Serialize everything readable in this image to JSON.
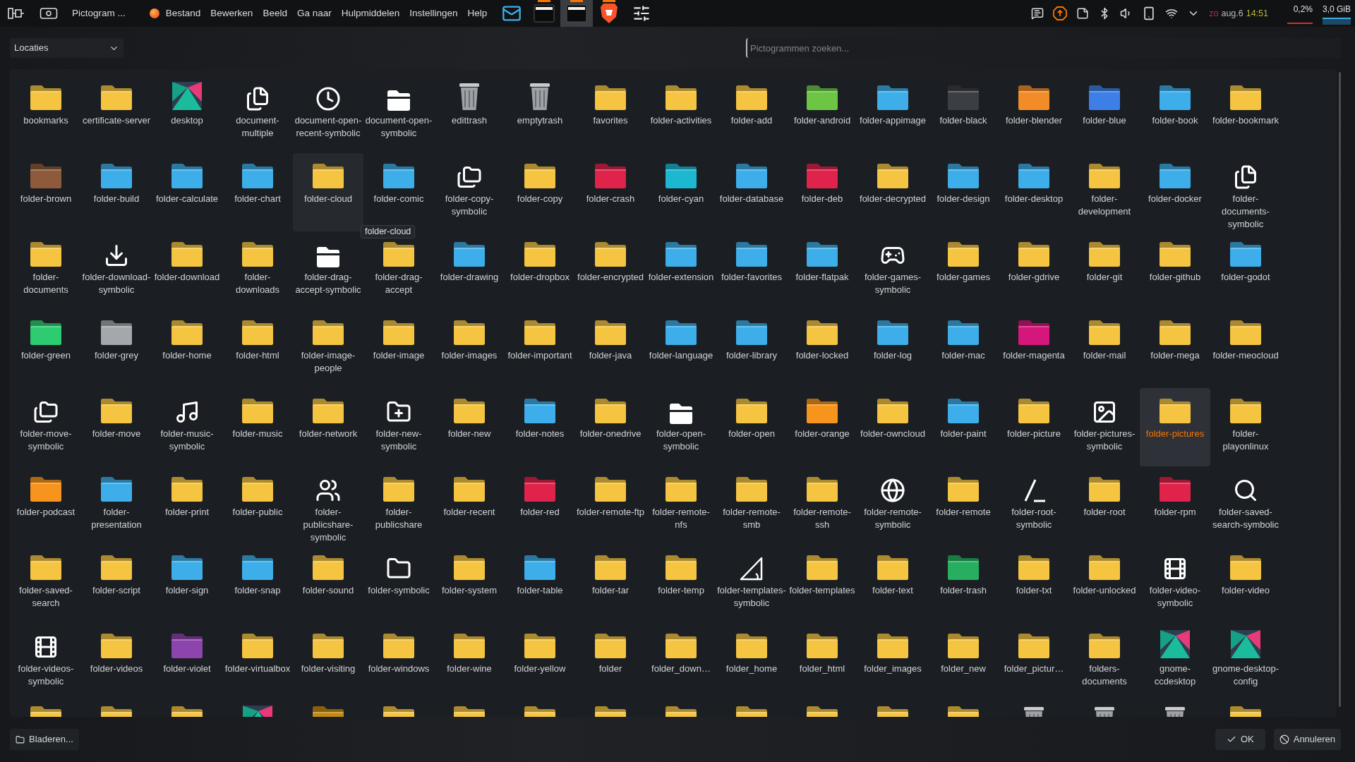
{
  "topbar": {
    "title": "Pictogram ...",
    "menu": [
      "Bestand",
      "Bewerken",
      "Beeld",
      "Ga naar",
      "Hulpmiddelen",
      "Instellingen",
      "Help"
    ],
    "tasks": [
      {
        "kind": "mail",
        "active": false,
        "running": false
      },
      {
        "kind": "window",
        "active": false,
        "running": true
      },
      {
        "kind": "window",
        "active": true,
        "running": true
      },
      {
        "kind": "browser",
        "active": false,
        "running": true
      },
      {
        "kind": "settings",
        "active": false,
        "running": false
      }
    ],
    "clock": {
      "day": "zo",
      "date": "aug.6",
      "time": "14:51"
    },
    "monitors": [
      "0,2%",
      "3,0 GiB"
    ]
  },
  "dialog": {
    "location": "Locaties",
    "search": {
      "placeholder": "Pictogrammen zoeken..."
    },
    "tooltip": "folder-cloud",
    "icons": [
      {
        "label": "bookmarks",
        "kind": "folder",
        "color": "#f5c542",
        "selected": false,
        "hovered": false
      },
      {
        "label": "certificate-server",
        "kind": "folder",
        "color": "#f5c542",
        "selected": false,
        "hovered": false
      },
      {
        "label": "desktop",
        "kind": "desktop",
        "selected": false,
        "hovered": false
      },
      {
        "label": "document-multiple",
        "kind": "files",
        "selected": false,
        "hovered": false
      },
      {
        "label": "document-open-recent-symbolic",
        "kind": "clock",
        "selected": false,
        "hovered": false
      },
      {
        "label": "document-open-symbolic",
        "kind": "whitefolder",
        "selected": false,
        "hovered": false
      },
      {
        "label": "edittrash",
        "kind": "trash",
        "selected": false,
        "hovered": false
      },
      {
        "label": "emptytrash",
        "kind": "trash",
        "selected": false,
        "hovered": false
      },
      {
        "label": "favorites",
        "kind": "folder",
        "color": "#f5c542",
        "selected": false,
        "hovered": false
      },
      {
        "label": "folder-activities",
        "kind": "folder",
        "color": "#f5c542",
        "selected": false,
        "hovered": false
      },
      {
        "label": "folder-add",
        "kind": "folder",
        "color": "#f5c542",
        "selected": false,
        "hovered": false
      },
      {
        "label": "folder-android",
        "kind": "folder",
        "color": "#6cc644",
        "selected": false,
        "hovered": false
      },
      {
        "label": "folder-appimage",
        "kind": "folder",
        "color": "#3daee9",
        "selected": false,
        "hovered": false
      },
      {
        "label": "folder-black",
        "kind": "folder",
        "color": "#3b3e42",
        "selected": false,
        "hovered": false
      },
      {
        "label": "folder-blender",
        "kind": "folder",
        "color": "#f28c28",
        "selected": false,
        "hovered": false
      },
      {
        "label": "folder-blue",
        "kind": "folder",
        "color": "#3d7fe6",
        "selected": false,
        "hovered": false
      },
      {
        "label": "folder-book",
        "kind": "folder",
        "color": "#3daee9",
        "selected": false,
        "hovered": false
      },
      {
        "label": "folder-bookmark",
        "kind": "folder",
        "color": "#f5c542",
        "selected": false,
        "hovered": false
      },
      {
        "label": "folder-brown",
        "kind": "folder",
        "color": "#8d5b3c",
        "selected": false,
        "hovered": false
      },
      {
        "label": "folder-build",
        "kind": "folder",
        "color": "#3daee9",
        "selected": false,
        "hovered": false
      },
      {
        "label": "folder-calculate",
        "kind": "folder",
        "color": "#3daee9",
        "selected": false,
        "hovered": false
      },
      {
        "label": "folder-chart",
        "kind": "folder",
        "color": "#3daee9",
        "selected": false,
        "hovered": false
      },
      {
        "label": "folder-cloud",
        "kind": "folder",
        "color": "#f5c542",
        "selected": false,
        "hovered": true
      },
      {
        "label": "folder-comic",
        "kind": "folder",
        "color": "#3daee9",
        "selected": false,
        "hovered": false
      },
      {
        "label": "folder-copy-symbolic",
        "kind": "folders",
        "selected": false,
        "hovered": false
      },
      {
        "label": "folder-copy",
        "kind": "folder",
        "color": "#f5c542",
        "selected": false,
        "hovered": false
      },
      {
        "label": "folder-crash",
        "kind": "folder",
        "color": "#e0234b",
        "selected": false,
        "hovered": false
      },
      {
        "label": "folder-cyan",
        "kind": "folder",
        "color": "#1cb7d1",
        "selected": false,
        "hovered": false
      },
      {
        "label": "folder-database",
        "kind": "folder",
        "color": "#3daee9",
        "selected": false,
        "hovered": false
      },
      {
        "label": "folder-deb",
        "kind": "folder",
        "color": "#e0234b",
        "selected": false,
        "hovered": false
      },
      {
        "label": "folder-decrypted",
        "kind": "folder",
        "color": "#f5c542",
        "selected": false,
        "hovered": false
      },
      {
        "label": "folder-design",
        "kind": "folder",
        "color": "#3daee9",
        "selected": false,
        "hovered": false
      },
      {
        "label": "folder-desktop",
        "kind": "folder",
        "color": "#3daee9",
        "selected": false,
        "hovered": false
      },
      {
        "label": "folder-development",
        "kind": "folder",
        "color": "#f5c542",
        "selected": false,
        "hovered": false
      },
      {
        "label": "folder-docker",
        "kind": "folder",
        "color": "#3daee9",
        "selected": false,
        "hovered": false
      },
      {
        "label": "folder-documents-symbolic",
        "kind": "files",
        "selected": false,
        "hovered": false
      },
      {
        "label": "folder-documents",
        "kind": "folder",
        "color": "#f5c542",
        "selected": false,
        "hovered": false
      },
      {
        "label": "folder-download-symbolic",
        "kind": "download",
        "selected": false,
        "hovered": false
      },
      {
        "label": "folder-download",
        "kind": "folder",
        "color": "#f5c542",
        "selected": false,
        "hovered": false
      },
      {
        "label": "folder-downloads",
        "kind": "folder",
        "color": "#f5c542",
        "selected": false,
        "hovered": false
      },
      {
        "label": "folder-drag-accept-symbolic",
        "kind": "whitefolder",
        "selected": false,
        "hovered": false
      },
      {
        "label": "folder-drag-accept",
        "kind": "folder",
        "color": "#f5c542",
        "selected": false,
        "hovered": false
      },
      {
        "label": "folder-drawing",
        "kind": "folder",
        "color": "#3daee9",
        "selected": false,
        "hovered": false
      },
      {
        "label": "folder-dropbox",
        "kind": "folder",
        "color": "#f5c542",
        "selected": false,
        "hovered": false
      },
      {
        "label": "folder-encrypted",
        "kind": "folder",
        "color": "#f5c542",
        "selected": false,
        "hovered": false
      },
      {
        "label": "folder-extension",
        "kind": "folder",
        "color": "#3daee9",
        "selected": false,
        "hovered": false
      },
      {
        "label": "folder-favorites",
        "kind": "folder",
        "color": "#3daee9",
        "selected": false,
        "hovered": false
      },
      {
        "label": "folder-flatpak",
        "kind": "folder",
        "color": "#3daee9",
        "selected": false,
        "hovered": false
      },
      {
        "label": "folder-games-symbolic",
        "kind": "gamepad",
        "selected": false,
        "hovered": false
      },
      {
        "label": "folder-games",
        "kind": "folder",
        "color": "#f5c542",
        "selected": false,
        "hovered": false
      },
      {
        "label": "folder-gdrive",
        "kind": "folder",
        "color": "#f5c542",
        "selected": false,
        "hovered": false
      },
      {
        "label": "folder-git",
        "kind": "folder",
        "color": "#f5c542",
        "selected": false,
        "hovered": false
      },
      {
        "label": "folder-github",
        "kind": "folder",
        "color": "#f5c542",
        "selected": false,
        "hovered": false
      },
      {
        "label": "folder-godot",
        "kind": "folder",
        "color": "#3daee9",
        "selected": false,
        "hovered": false
      },
      {
        "label": "folder-green",
        "kind": "folder",
        "color": "#2ecc71",
        "selected": false,
        "hovered": false
      },
      {
        "label": "folder-grey",
        "kind": "folder",
        "color": "#a4a8ad",
        "selected": false,
        "hovered": false
      },
      {
        "label": "folder-home",
        "kind": "folder",
        "color": "#f5c542",
        "selected": false,
        "hovered": false
      },
      {
        "label": "folder-html",
        "kind": "folder",
        "color": "#f5c542",
        "selected": false,
        "hovered": false
      },
      {
        "label": "folder-image-people",
        "kind": "folder",
        "color": "#f5c542",
        "selected": false,
        "hovered": false
      },
      {
        "label": "folder-image",
        "kind": "folder",
        "color": "#f5c542",
        "selected": false,
        "hovered": false
      },
      {
        "label": "folder-images",
        "kind": "folder",
        "color": "#f5c542",
        "selected": false,
        "hovered": false
      },
      {
        "label": "folder-important",
        "kind": "folder",
        "color": "#f5c542",
        "selected": false,
        "hovered": false
      },
      {
        "label": "folder-java",
        "kind": "folder",
        "color": "#f5c542",
        "selected": false,
        "hovered": false
      },
      {
        "label": "folder-language",
        "kind": "folder",
        "color": "#3daee9",
        "selected": false,
        "hovered": false
      },
      {
        "label": "folder-library",
        "kind": "folder",
        "color": "#3daee9",
        "selected": false,
        "hovered": false
      },
      {
        "label": "folder-locked",
        "kind": "folder",
        "color": "#f5c542",
        "selected": false,
        "hovered": false
      },
      {
        "label": "folder-log",
        "kind": "folder",
        "color": "#3daee9",
        "selected": false,
        "hovered": false
      },
      {
        "label": "folder-mac",
        "kind": "folder",
        "color": "#3daee9",
        "selected": false,
        "hovered": false
      },
      {
        "label": "folder-magenta",
        "kind": "folder",
        "color": "#d5167a",
        "selected": false,
        "hovered": false
      },
      {
        "label": "folder-mail",
        "kind": "folder",
        "color": "#f5c542",
        "selected": false,
        "hovered": false
      },
      {
        "label": "folder-mega",
        "kind": "folder",
        "color": "#f5c542",
        "selected": false,
        "hovered": false
      },
      {
        "label": "folder-meocloud",
        "kind": "folder",
        "color": "#f5c542",
        "selected": false,
        "hovered": false
      },
      {
        "label": "folder-move-symbolic",
        "kind": "folders",
        "selected": false,
        "hovered": false
      },
      {
        "label": "folder-move",
        "kind": "folder",
        "color": "#f5c542",
        "selected": false,
        "hovered": false
      },
      {
        "label": "folder-music-symbolic",
        "kind": "music",
        "selected": false,
        "hovered": false
      },
      {
        "label": "folder-music",
        "kind": "folder",
        "color": "#f5c542",
        "selected": false,
        "hovered": false
      },
      {
        "label": "folder-network",
        "kind": "folder",
        "color": "#f5c542",
        "selected": false,
        "hovered": false
      },
      {
        "label": "folder-new-symbolic",
        "kind": "folderplus",
        "selected": false,
        "hovered": false
      },
      {
        "label": "folder-new",
        "kind": "folder",
        "color": "#f5c542",
        "selected": false,
        "hovered": false
      },
      {
        "label": "folder-notes",
        "kind": "folder",
        "color": "#3daee9",
        "selected": false,
        "hovered": false
      },
      {
        "label": "folder-onedrive",
        "kind": "folder",
        "color": "#f5c542",
        "selected": false,
        "hovered": false
      },
      {
        "label": "folder-open-symbolic",
        "kind": "whitefolder",
        "selected": false,
        "hovered": false
      },
      {
        "label": "folder-open",
        "kind": "folder",
        "color": "#f5c542",
        "selected": false,
        "hovered": false
      },
      {
        "label": "folder-orange",
        "kind": "folder",
        "color": "#f7941d",
        "selected": false,
        "hovered": false
      },
      {
        "label": "folder-owncloud",
        "kind": "folder",
        "color": "#f5c542",
        "selected": false,
        "hovered": false
      },
      {
        "label": "folder-paint",
        "kind": "folder",
        "color": "#3daee9",
        "selected": false,
        "hovered": false
      },
      {
        "label": "folder-picture",
        "kind": "folder",
        "color": "#f5c542",
        "selected": false,
        "hovered": false
      },
      {
        "label": "folder-pictures-symbolic",
        "kind": "image",
        "selected": false,
        "hovered": false
      },
      {
        "label": "folder-pictures",
        "kind": "folder",
        "color": "#f5c542",
        "selected": true,
        "hovered": false
      },
      {
        "label": "folder-playonlinux",
        "kind": "folder",
        "color": "#f5c542",
        "selected": false,
        "hovered": false
      },
      {
        "label": "folder-podcast",
        "kind": "folder",
        "color": "#f7941d",
        "selected": false,
        "hovered": false
      },
      {
        "label": "folder-presentation",
        "kind": "folder",
        "color": "#3daee9",
        "selected": false,
        "hovered": false
      },
      {
        "label": "folder-print",
        "kind": "folder",
        "color": "#f5c542",
        "selected": false,
        "hovered": false
      },
      {
        "label": "folder-public",
        "kind": "folder",
        "color": "#f5c542",
        "selected": false,
        "hovered": false
      },
      {
        "label": "folder-publicshare-symbolic",
        "kind": "users",
        "selected": false,
        "hovered": false
      },
      {
        "label": "folder-publicshare",
        "kind": "folder",
        "color": "#f5c542",
        "selected": false,
        "hovered": false
      },
      {
        "label": "folder-recent",
        "kind": "folder",
        "color": "#f5c542",
        "selected": false,
        "hovered": false
      },
      {
        "label": "folder-red",
        "kind": "folder",
        "color": "#e0234b",
        "selected": false,
        "hovered": false
      },
      {
        "label": "folder-remote-ftp",
        "kind": "folder",
        "color": "#f5c542",
        "selected": false,
        "hovered": false
      },
      {
        "label": "folder-remote-nfs",
        "kind": "folder",
        "color": "#f5c542",
        "selected": false,
        "hovered": false
      },
      {
        "label": "folder-remote-smb",
        "kind": "folder",
        "color": "#f5c542",
        "selected": false,
        "hovered": false
      },
      {
        "label": "folder-remote-ssh",
        "kind": "folder",
        "color": "#f5c542",
        "selected": false,
        "hovered": false
      },
      {
        "label": "folder-remote-symbolic",
        "kind": "globe",
        "selected": false,
        "hovered": false
      },
      {
        "label": "folder-remote",
        "kind": "folder",
        "color": "#f5c542",
        "selected": false,
        "hovered": false
      },
      {
        "label": "folder-root-symbolic",
        "kind": "slash",
        "selected": false,
        "hovered": false
      },
      {
        "label": "folder-root",
        "kind": "folder",
        "color": "#f5c542",
        "selected": false,
        "hovered": false
      },
      {
        "label": "folder-rpm",
        "kind": "folder",
        "color": "#e0234b",
        "selected": false,
        "hovered": false
      },
      {
        "label": "folder-saved-search-symbolic",
        "kind": "search",
        "selected": false,
        "hovered": false
      },
      {
        "label": "folder-saved-search",
        "kind": "folder",
        "color": "#f5c542",
        "selected": false,
        "hovered": false
      },
      {
        "label": "folder-script",
        "kind": "folder",
        "color": "#f5c542",
        "selected": false,
        "hovered": false
      },
      {
        "label": "folder-sign",
        "kind": "folder",
        "color": "#3daee9",
        "selected": false,
        "hovered": false
      },
      {
        "label": "folder-snap",
        "kind": "folder",
        "color": "#3daee9",
        "selected": false,
        "hovered": false
      },
      {
        "label": "folder-sound",
        "kind": "folder",
        "color": "#f5c542",
        "selected": false,
        "hovered": false
      },
      {
        "label": "folder-symbolic",
        "kind": "outlinefolder",
        "selected": false,
        "hovered": false
      },
      {
        "label": "folder-system",
        "kind": "folder",
        "color": "#f5c542",
        "selected": false,
        "hovered": false
      },
      {
        "label": "folder-table",
        "kind": "folder",
        "color": "#3daee9",
        "selected": false,
        "hovered": false
      },
      {
        "label": "folder-tar",
        "kind": "folder",
        "color": "#f5c542",
        "selected": false,
        "hovered": false
      },
      {
        "label": "folder-temp",
        "kind": "folder",
        "color": "#f5c542",
        "selected": false,
        "hovered": false
      },
      {
        "label": "folder-templates-symbolic",
        "kind": "triangle",
        "selected": false,
        "hovered": false
      },
      {
        "label": "folder-templates",
        "kind": "folder",
        "color": "#f5c542",
        "selected": false,
        "hovered": false
      },
      {
        "label": "folder-text",
        "kind": "folder",
        "color": "#f5c542",
        "selected": false,
        "hovered": false
      },
      {
        "label": "folder-trash",
        "kind": "folder",
        "color": "#27ae60",
        "selected": false,
        "hovered": false
      },
      {
        "label": "folder-txt",
        "kind": "folder",
        "color": "#f5c542",
        "selected": false,
        "hovered": false
      },
      {
        "label": "folder-unlocked",
        "kind": "folder",
        "color": "#f5c542",
        "selected": false,
        "hovered": false
      },
      {
        "label": "folder-video-symbolic",
        "kind": "film",
        "selected": false,
        "hovered": false
      },
      {
        "label": "folder-video",
        "kind": "folder",
        "color": "#f5c542",
        "selected": false,
        "hovered": false
      },
      {
        "label": "folder-videos-symbolic",
        "kind": "film",
        "selected": false,
        "hovered": false
      },
      {
        "label": "folder-videos",
        "kind": "folder",
        "color": "#f5c542",
        "selected": false,
        "hovered": false
      },
      {
        "label": "folder-violet",
        "kind": "folder",
        "color": "#8e44ad",
        "selected": false,
        "hovered": false
      },
      {
        "label": "folder-virtualbox",
        "kind": "folder",
        "color": "#f5c542",
        "selected": false,
        "hovered": false
      },
      {
        "label": "folder-visiting",
        "kind": "folder",
        "color": "#f5c542",
        "selected": false,
        "hovered": false
      },
      {
        "label": "folder-windows",
        "kind": "folder",
        "color": "#f5c542",
        "selected": false,
        "hovered": false
      },
      {
        "label": "folder-wine",
        "kind": "folder",
        "color": "#f5c542",
        "selected": false,
        "hovered": false
      },
      {
        "label": "folder-yellow",
        "kind": "folder",
        "color": "#f5c542",
        "selected": false,
        "hovered": false
      },
      {
        "label": "folder",
        "kind": "folder",
        "color": "#f5c542",
        "selected": false,
        "hovered": false
      },
      {
        "label": "folder_down…",
        "kind": "folder",
        "color": "#f5c542",
        "selected": false,
        "hovered": false
      },
      {
        "label": "folder_home",
        "kind": "folder",
        "color": "#f5c542",
        "selected": false,
        "hovered": false
      },
      {
        "label": "folder_html",
        "kind": "folder",
        "color": "#f5c542",
        "selected": false,
        "hovered": false
      },
      {
        "label": "folder_images",
        "kind": "folder",
        "color": "#f5c542",
        "selected": false,
        "hovered": false
      },
      {
        "label": "folder_new",
        "kind": "folder",
        "color": "#f5c542",
        "selected": false,
        "hovered": false
      },
      {
        "label": "folder_pictur…",
        "kind": "folder",
        "color": "#f5c542",
        "selected": false,
        "hovered": false
      },
      {
        "label": "folders-documents",
        "kind": "folder",
        "color": "#f5c542",
        "selected": false,
        "hovered": false
      },
      {
        "label": "gnome-ccdesktop",
        "kind": "desktop",
        "selected": false,
        "hovered": false
      },
      {
        "label": "gnome-desktop-config",
        "kind": "desktop",
        "selected": false,
        "hovered": false
      }
    ],
    "partial_row": [
      {
        "kind": "folder",
        "color": "#f5c542"
      },
      {
        "kind": "folder",
        "color": "#f5c542"
      },
      {
        "kind": "folder",
        "color": "#f5c542"
      },
      {
        "kind": "desktop"
      },
      {
        "kind": "folder",
        "color": "#c08a12"
      },
      {
        "kind": "folder",
        "color": "#f5c542"
      },
      {
        "kind": "folder",
        "color": "#f5c542"
      },
      {
        "kind": "folder",
        "color": "#f5c542"
      },
      {
        "kind": "folder",
        "color": "#f5c542"
      },
      {
        "kind": "folder",
        "color": "#f5c542"
      },
      {
        "kind": "folder",
        "color": "#f5c542"
      },
      {
        "kind": "folder",
        "color": "#f5c542"
      },
      {
        "kind": "folder",
        "color": "#f5c542"
      },
      {
        "kind": "folder",
        "color": "#f5c542"
      },
      {
        "kind": "trash"
      },
      {
        "kind": "trash"
      },
      {
        "kind": "trash"
      },
      {
        "kind": "folder",
        "color": "#f5c542"
      }
    ],
    "buttons": {
      "browse": "Bladeren...",
      "ok": "OK",
      "cancel": "Annuleren"
    }
  }
}
